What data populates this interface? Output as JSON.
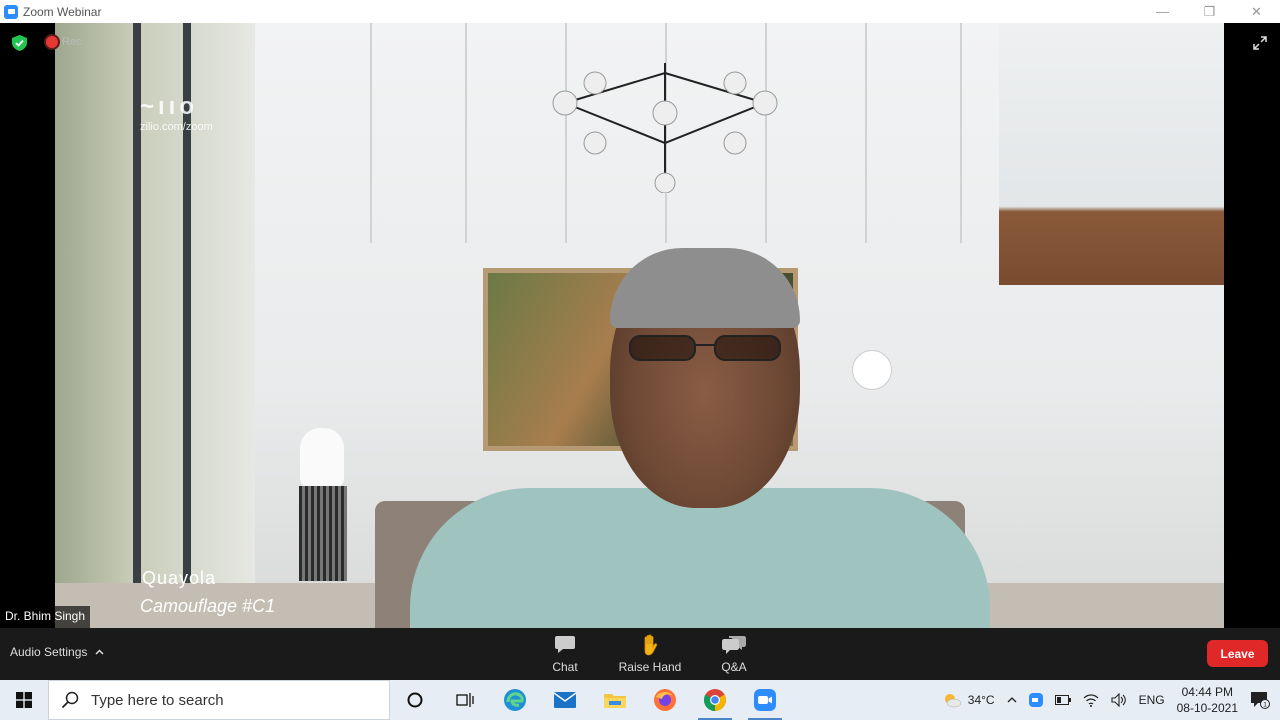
{
  "window": {
    "title": "Zoom Webinar"
  },
  "recording": {
    "label": "Rec"
  },
  "video": {
    "watermark_site": "zilio.com/zoom",
    "caption_line1": "Quayola",
    "caption_line2": "Camouflage #C1",
    "participant_name": "Dr. Bhim Singh"
  },
  "toolbar": {
    "audio_settings_label": "Audio Settings",
    "chat_label": "Chat",
    "raise_hand_label": "Raise Hand",
    "qa_label": "Q&A",
    "leave_label": "Leave"
  },
  "taskbar": {
    "search_placeholder": "Type here to search",
    "weather": "34°C",
    "language": "ENG",
    "time": "04:44 PM",
    "date": "08-10-2021",
    "notification_count": "1"
  },
  "colors": {
    "leave_red": "#e02828",
    "toolbar_bg": "#1a1a1a",
    "taskbar_bg": "#e6edf4",
    "zoom_blue": "#2d8cff"
  }
}
